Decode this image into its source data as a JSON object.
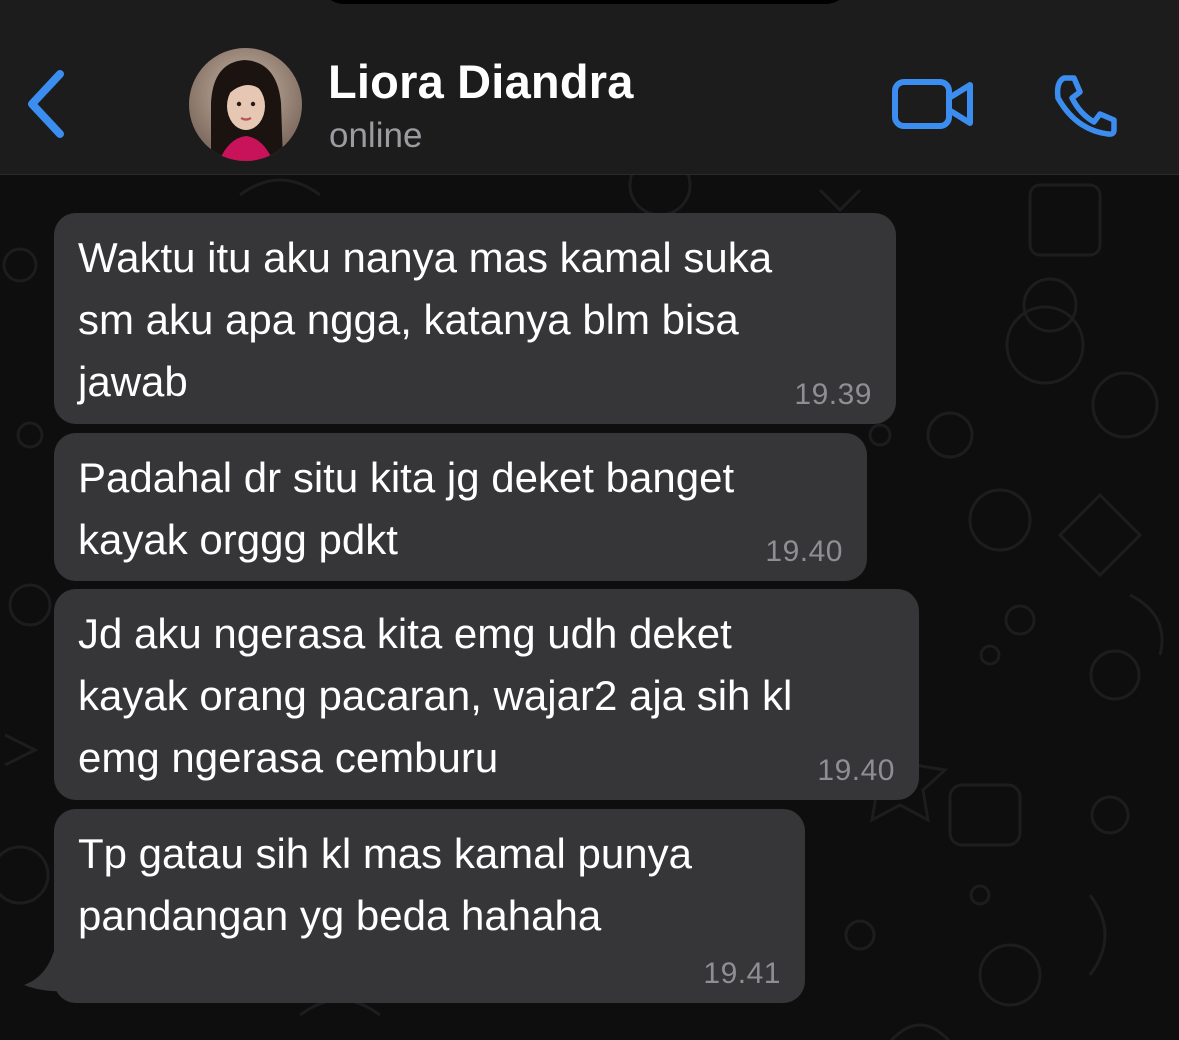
{
  "header": {
    "contact_name": "Liora Diandra",
    "status": "online",
    "accent_color": "#3b8ef0",
    "icons": {
      "back": "chevron-left-icon",
      "video": "video-camera-icon",
      "call": "phone-icon"
    }
  },
  "messages": [
    {
      "text": "Waktu itu aku nanya mas kamal suka\nsm aku apa ngga, katanya blm bisa\njawab",
      "time": "19.39"
    },
    {
      "text": "Padahal dr situ kita jg deket banget\nkayak orggg pdkt",
      "time": "19.40"
    },
    {
      "text": "Jd aku ngerasa kita emg udh deket\nkayak orang pacaran, wajar2 aja sih kl\nemg ngerasa cemburu",
      "time": "19.40"
    },
    {
      "text": "Tp gatau sih kl mas kamal punya\npandangan yg beda hahaha",
      "time": "19.41"
    }
  ],
  "colors": {
    "header_bg": "#1c1c1d",
    "bubble_bg": "#363638",
    "timestamp": "#8e8e93",
    "status": "#9b9ba0"
  }
}
